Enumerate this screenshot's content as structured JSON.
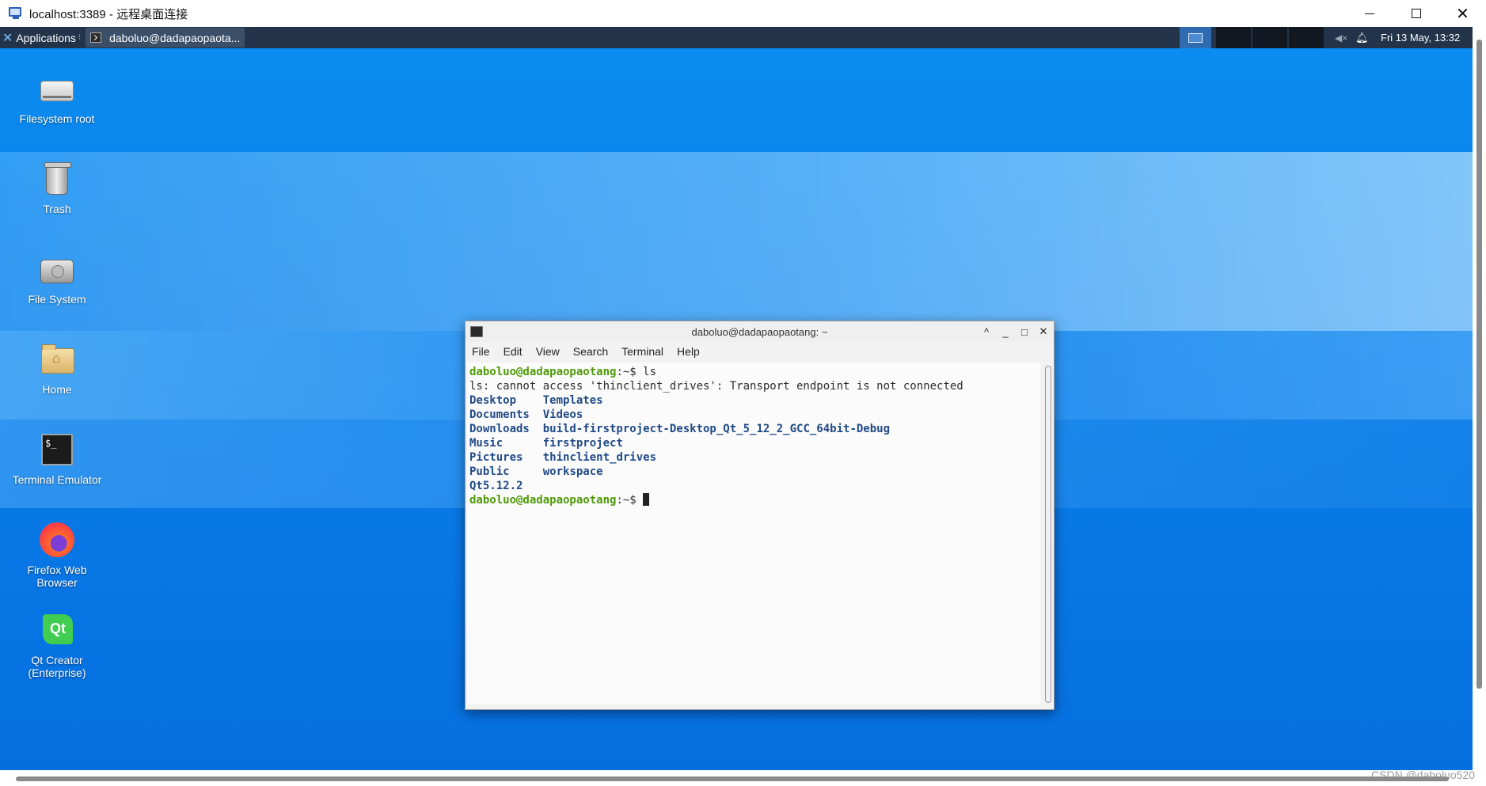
{
  "rdp_window": {
    "title": "localhost:3389 - 远程桌面连接",
    "minimize": "—",
    "maximize": "☐",
    "close": "✕"
  },
  "panel": {
    "applications_label": "Applications",
    "task_label": "daboluo@dadapaopaota...",
    "clock": "Fri 13 May, 13:32"
  },
  "desktop_icons": [
    {
      "label": "Filesystem root",
      "icon": "drive-icon"
    },
    {
      "label": "Trash",
      "icon": "trash-icon"
    },
    {
      "label": "File System",
      "icon": "hdd-icon"
    },
    {
      "label": "Home",
      "icon": "home-folder-icon"
    },
    {
      "label": "Terminal Emulator",
      "icon": "terminal-icon",
      "glyph": "$_"
    },
    {
      "label": "Firefox Web Browser",
      "icon": "firefox-icon"
    },
    {
      "label": "Qt Creator (Enterprise)",
      "icon": "qt-creator-icon",
      "glyph": "Qt"
    }
  ],
  "terminal": {
    "title": "daboluo@dadapaopaotang: ~",
    "controls": [
      "^",
      "_",
      "□",
      "✕"
    ],
    "menu": [
      "File",
      "Edit",
      "View",
      "Search",
      "Terminal",
      "Help"
    ],
    "prompt": "daboluo@dadapaopaotang",
    "prompt_suffix": ":~$ ",
    "command": "ls",
    "error": "ls: cannot access 'thinclient_drives': Transport endpoint is not connected",
    "listing": [
      [
        "Desktop",
        "Templates"
      ],
      [
        "Documents",
        "Videos"
      ],
      [
        "Downloads",
        "build-firstproject-Desktop_Qt_5_12_2_GCC_64bit-Debug"
      ],
      [
        "Music",
        "firstproject"
      ],
      [
        "Pictures",
        "thinclient_drives"
      ],
      [
        "Public",
        "workspace"
      ],
      [
        "Qt5.12.2",
        ""
      ]
    ]
  },
  "watermark": "CSDN @daboluo520",
  "colors": {
    "panel_bg": "#23344a",
    "desktop_blue": "#0a7ee9",
    "prompt_green": "#4e9a06",
    "dir_blue": "#204a87"
  }
}
